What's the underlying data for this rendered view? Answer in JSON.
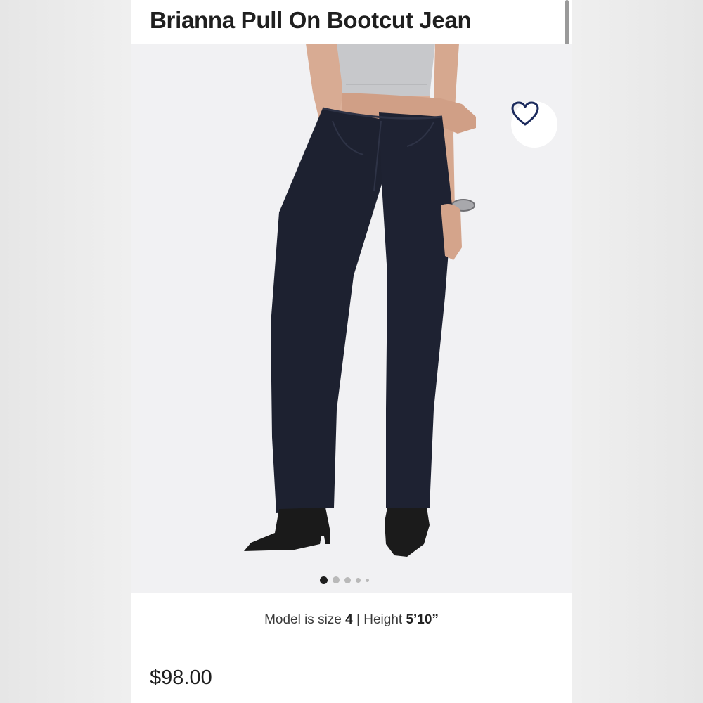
{
  "product": {
    "title": "Brianna Pull On Bootcut Jean",
    "price": "$98.00"
  },
  "gallery": {
    "image_count": 5,
    "active_index": 0,
    "favorite_icon": "heart-outline-icon"
  },
  "model_info": {
    "size_label": "Model is size",
    "size_value": "4",
    "separator": "|",
    "height_label": "Height",
    "height_value": "5’10”"
  },
  "colors": {
    "denim": "#1d2130",
    "heart": "#1b2a5c"
  }
}
